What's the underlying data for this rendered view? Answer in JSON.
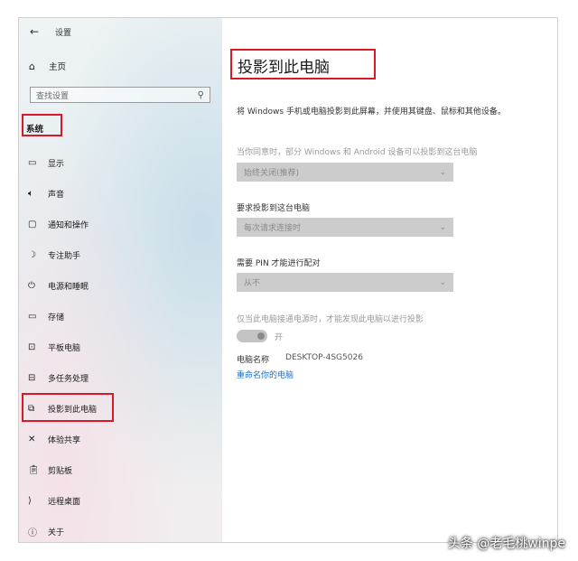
{
  "header": {
    "back_icon": "back-arrow-icon",
    "title": "设置"
  },
  "home": {
    "icon": "home-icon",
    "label": "主页"
  },
  "search": {
    "placeholder": "查找设置",
    "icon": "search-icon"
  },
  "section_label": "系统",
  "sidebar": {
    "items": [
      {
        "label": "显示",
        "icon": "monitor-icon"
      },
      {
        "label": "声音",
        "icon": "speaker-icon"
      },
      {
        "label": "通知和操作",
        "icon": "notification-icon"
      },
      {
        "label": "专注助手",
        "icon": "moon-icon"
      },
      {
        "label": "电源和睡眠",
        "icon": "power-icon"
      },
      {
        "label": "存储",
        "icon": "storage-icon"
      },
      {
        "label": "平板电脑",
        "icon": "tablet-icon"
      },
      {
        "label": "多任务处理",
        "icon": "multitask-icon"
      },
      {
        "label": "投影到此电脑",
        "icon": "project-icon",
        "selected": true
      },
      {
        "label": "体验共享",
        "icon": "share-icon"
      },
      {
        "label": "剪贴板",
        "icon": "clipboard-icon"
      },
      {
        "label": "远程桌面",
        "icon": "remote-icon"
      },
      {
        "label": "关于",
        "icon": "info-icon"
      }
    ]
  },
  "main": {
    "title": "投影到此电脑",
    "description": "将 Windows 手机或电脑投影到此屏幕，并使用其键盘、鼠标和其他设备。",
    "setting1": {
      "label": "当你同意时，部分 Windows 和 Android 设备可以投影到这台电脑",
      "value": "始终关闭(推荐)"
    },
    "setting2": {
      "label": "要求投影到这台电脑",
      "value": "每次请求连接时"
    },
    "setting3": {
      "label": "需要 PIN 才能进行配对",
      "value": "从不"
    },
    "power_note": "仅当此电脑接通电源时，才能发现此电脑以进行投影",
    "toggle_label": "开",
    "pc_name_label": "电脑名称",
    "pc_name_value": "DESKTOP-4SG5026",
    "rename_link": "重命名你的电脑"
  },
  "watermark": "头条 @老毛桃winpe",
  "colors": {
    "highlight_border": "#d7192a",
    "link": "#1a6fc4"
  }
}
